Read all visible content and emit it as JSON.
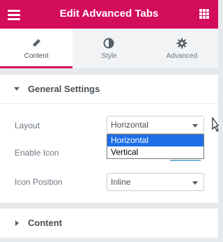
{
  "header": {
    "title": "Edit Advanced Tabs",
    "menu_icon": "hamburger-icon",
    "widgets_icon": "grid-icon"
  },
  "tabs": [
    {
      "label": "Content",
      "icon": "pencil-icon",
      "active": true
    },
    {
      "label": "Style",
      "icon": "half-circle-icon",
      "active": false
    },
    {
      "label": "Advanced",
      "icon": "gear-icon",
      "active": false
    }
  ],
  "general_settings": {
    "title": "General Settings",
    "layout": {
      "label": "Layout",
      "value": "Horizontal",
      "options": [
        "Horizontal",
        "Vertical"
      ]
    },
    "enable_icon": {
      "label": "Enable Icon"
    },
    "icon_position": {
      "label": "Icon Position",
      "value": "Inline"
    }
  },
  "content_section": {
    "title": "Content"
  },
  "colors": {
    "brand": "#d30c5c",
    "selected_option": "#1e6ee8"
  }
}
